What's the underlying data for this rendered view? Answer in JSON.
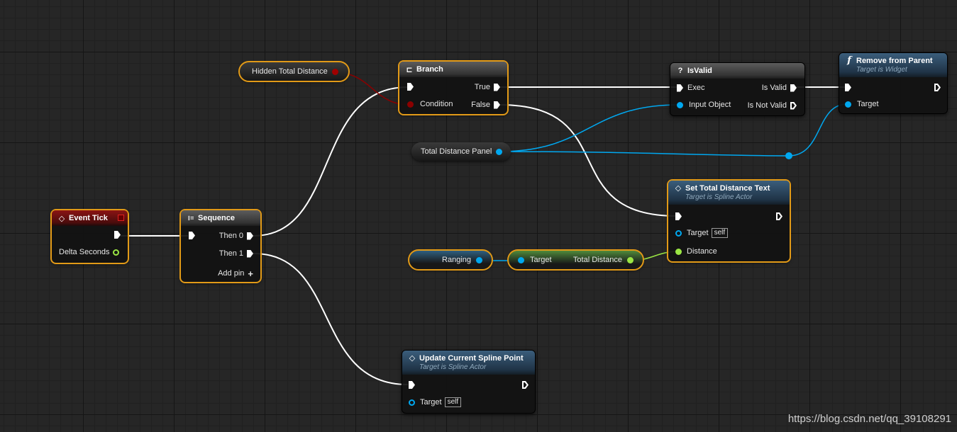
{
  "colors": {
    "exec": "#ffffff",
    "bool": "#8b0000",
    "object": "#00a8f0",
    "float": "#9be644",
    "selection": "#e29a17"
  },
  "nodes": {
    "event_tick": {
      "title": "Event Tick",
      "delta": "Delta Seconds",
      "icon": "event-diamond-icon"
    },
    "sequence": {
      "title": "Sequence",
      "then0": "Then 0",
      "then1": "Then 1",
      "add_pin": "Add pin",
      "add_icon": "+",
      "icon": "sequence-icon"
    },
    "branch": {
      "title": "Branch",
      "condition": "Condition",
      "true_label": "True",
      "false_label": "False",
      "icon": "branch-icon"
    },
    "is_valid": {
      "title": "IsValid",
      "icon_glyph": "?",
      "exec": "Exec",
      "input": "Input Object",
      "is_valid": "Is Valid",
      "is_not_valid": "Is Not Valid"
    },
    "remove_from_parent": {
      "title": "Remove from Parent",
      "subtitle": "Target is Widget",
      "icon_glyph": "f",
      "target": "Target"
    },
    "set_total_distance_text": {
      "title": "Set Total Distance Text",
      "subtitle": "Target is Spline Actor",
      "target": "Target",
      "self": "self",
      "distance": "Distance"
    },
    "update_current_spline_point": {
      "title": "Update Current Spline Point",
      "subtitle": "Target is Spline Actor",
      "target": "Target",
      "self": "self"
    },
    "get_total_distance": {
      "target": "Target",
      "output": "Total Distance"
    }
  },
  "variables": {
    "hidden_total_distance": "Hidden Total Distance",
    "total_distance_panel": "Total Distance Panel",
    "ranging": "Ranging"
  },
  "watermark": "https://blog.csdn.net/qq_39108291"
}
